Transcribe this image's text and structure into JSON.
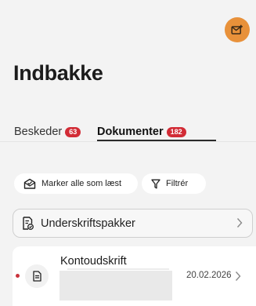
{
  "header": {
    "compose_icon": "mail-compose-icon",
    "title": "Indbakke"
  },
  "tabs": [
    {
      "label": "Beskeder",
      "count": "63",
      "active": false
    },
    {
      "label": "Dokumenter",
      "count": "182",
      "active": true
    }
  ],
  "actions": {
    "mark_all_read": "Marker alle som læst",
    "filter": "Filtrér"
  },
  "signature_packages": {
    "label": "Underskriftspakker"
  },
  "documents": [
    {
      "title": "Kontoudskrift",
      "date": "20.02.2026",
      "unread": true,
      "icon": "document-icon"
    }
  ],
  "colors": {
    "accent_orange": "#e8913a",
    "badge_red": "#d22c36",
    "unread_dot": "#c9323b",
    "background": "#f3f3f3"
  }
}
